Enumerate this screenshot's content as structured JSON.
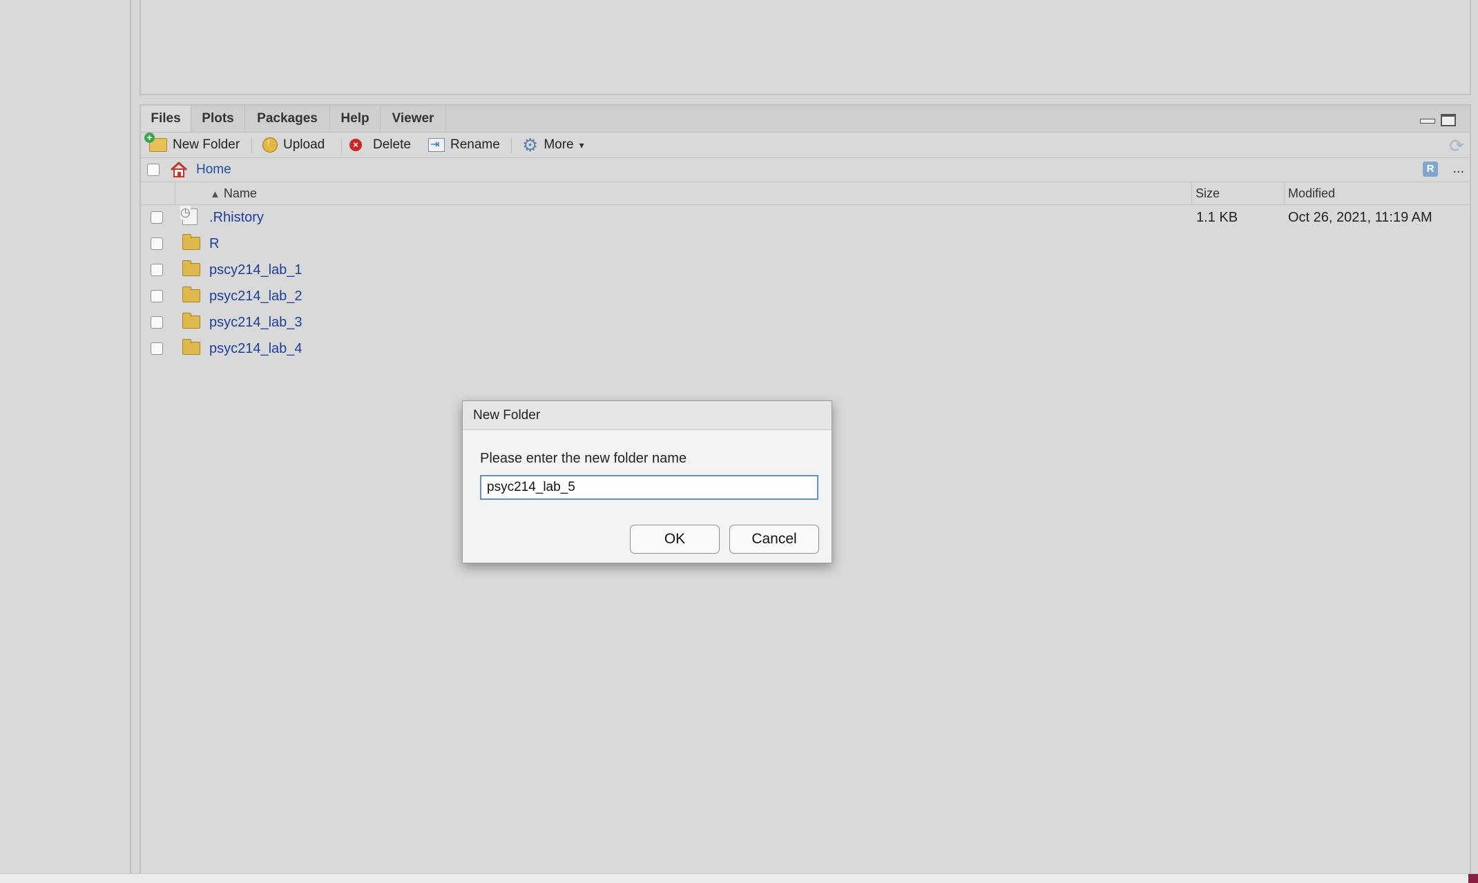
{
  "tabs": [
    {
      "label": "Files",
      "active": true
    },
    {
      "label": "Plots",
      "active": false
    },
    {
      "label": "Packages",
      "active": false
    },
    {
      "label": "Help",
      "active": false
    },
    {
      "label": "Viewer",
      "active": false
    }
  ],
  "toolbar": {
    "new_folder": "New Folder",
    "upload": "Upload",
    "delete": "Delete",
    "rename": "Rename",
    "more": "More"
  },
  "path": {
    "home": "Home",
    "overflow": "..."
  },
  "columns": {
    "name": "Name",
    "size": "Size",
    "modified": "Modified"
  },
  "files": [
    {
      "name": ".Rhistory",
      "type": "file",
      "size": "1.1 KB",
      "modified": "Oct 26, 2021, 11:19 AM"
    },
    {
      "name": "R",
      "type": "folder",
      "size": "",
      "modified": ""
    },
    {
      "name": "pscy214_lab_1",
      "type": "folder",
      "size": "",
      "modified": ""
    },
    {
      "name": "psyc214_lab_2",
      "type": "folder",
      "size": "",
      "modified": ""
    },
    {
      "name": "psyc214_lab_3",
      "type": "folder",
      "size": "",
      "modified": ""
    },
    {
      "name": "psyc214_lab_4",
      "type": "folder",
      "size": "",
      "modified": ""
    }
  ],
  "dialog": {
    "title": "New Folder",
    "prompt": "Please enter the new folder name",
    "input_value": "psyc214_lab_5",
    "ok": "OK",
    "cancel": "Cancel"
  },
  "colors": {
    "link": "#1d3f9a",
    "accent": "#5b8fd6",
    "folder": "#e0b94e"
  }
}
